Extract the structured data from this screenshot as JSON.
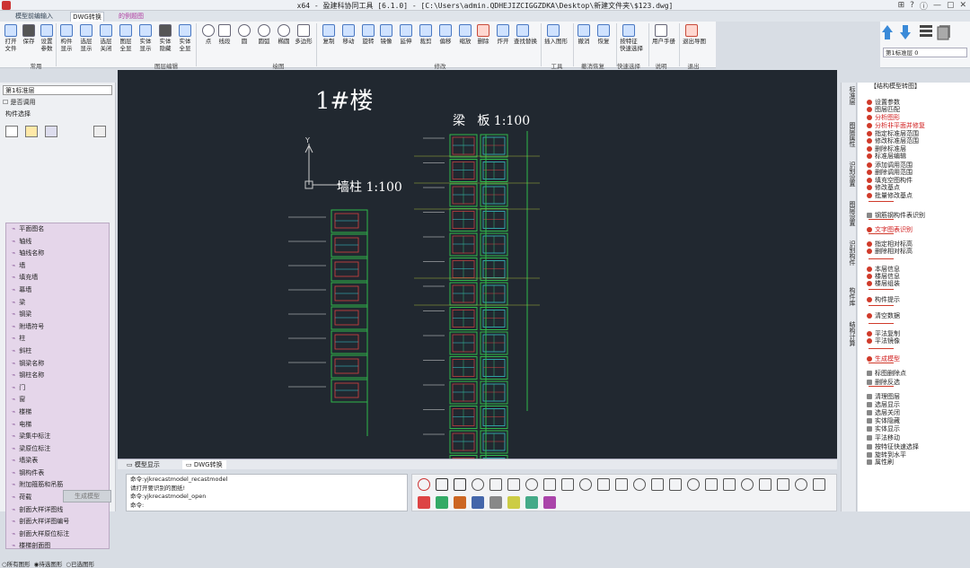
{
  "window": {
    "title": "x64 - 盈建科协同工具 [6.1.0] - [C:\\Users\\admin.QDHEJIZCIGGZDKA\\Desktop\\新建文件夹\\$123.dwg]",
    "controls": [
      "⊞",
      "?",
      "ⓘ",
      "—",
      "▢",
      "✕"
    ]
  },
  "tabs": [
    {
      "label": "模型前编输入"
    },
    {
      "label": "DWG转换"
    },
    {
      "label": "的例题图"
    }
  ],
  "ribbon": {
    "buttons": [
      {
        "label": "打开\n文件"
      },
      {
        "label": "保存"
      },
      {
        "label": "设置\n参数"
      },
      {
        "label": "构件\n显示"
      },
      {
        "label": "选层\n显示"
      },
      {
        "label": "选层\n关闭"
      },
      {
        "label": "图层\n全显"
      },
      {
        "label": "实体\n显示"
      },
      {
        "label": "实体\n隐藏"
      },
      {
        "label": "实体\n全显"
      },
      {
        "label": "点"
      },
      {
        "label": "线段"
      },
      {
        "label": "圆"
      },
      {
        "label": "圆弧"
      },
      {
        "label": "椭圆"
      },
      {
        "label": "多边形"
      },
      {
        "label": "复制"
      },
      {
        "label": "移动"
      },
      {
        "label": "旋转"
      },
      {
        "label": "镜像"
      },
      {
        "label": "延伸"
      },
      {
        "label": "裁剪"
      },
      {
        "label": "偏移"
      },
      {
        "label": "缩放"
      },
      {
        "label": "删除"
      },
      {
        "label": "炸开"
      },
      {
        "label": "查找替换"
      },
      {
        "label": "插入图形"
      },
      {
        "label": "撤消"
      },
      {
        "label": "恢复"
      },
      {
        "label": "按特征\n快速选择"
      },
      {
        "label": "用户手册"
      },
      {
        "label": "退出导图"
      }
    ],
    "groups": [
      "常用",
      "图层编辑",
      "绘图",
      "修改",
      "工具",
      "撤消恢复",
      "快速选择",
      "说明",
      "退出"
    ],
    "layer_select": "第1标准层 0"
  },
  "left_panel": {
    "floor_select": "第1标准层",
    "checkbox_label": "是否调用",
    "panel_title": "构件选择",
    "components": [
      "平面图名",
      "轴线",
      "轴线名称",
      "墙",
      "填充墙",
      "幕墙",
      "梁",
      "钢梁",
      "附墙符号",
      "柱",
      "斜柱",
      "钢梁名称",
      "钢柱名称",
      "门",
      "窗",
      "楼梯",
      "电梯",
      "梁集中标注",
      "梁原位标注",
      "墙梁表",
      "钢构件表",
      "附加箍筋和吊筋",
      "荷载",
      "剖面大样详图线",
      "剖面大样详图编号",
      "剖面大样原位标注",
      "楼梯剖面图"
    ],
    "radio_options": [
      "所有图形",
      "待选图形",
      "已选图形"
    ],
    "generate_button": "生成模型"
  },
  "canvas": {
    "title_building": "1#楼",
    "title_wall": "墙柱 1:100",
    "title_beam": "梁   板 1:100",
    "axis_y": "Y"
  },
  "canvas_tabs": [
    "模型显示",
    "DWG转换"
  ],
  "command_lines": [
    "命令:yjkrecastmodel_recastmodel",
    "请打开要识别的图纸!",
    "命令:yjkrecastmodel_open",
    "命令:"
  ],
  "right_vtabs": [
    "标准层",
    "图层属性",
    "识别设置",
    "图层设置",
    "识别构件",
    "构件库",
    "结构计算"
  ],
  "right_panel": {
    "header": "【结构模型转图】",
    "items": [
      {
        "label": "设置参数",
        "style": "dot"
      },
      {
        "label": "图层匹配",
        "style": "dot"
      },
      {
        "label": "分析图形",
        "style": "red"
      },
      {
        "label": "分析非平面并修复",
        "style": "red"
      },
      {
        "label": "指定标准层范围",
        "style": "dot"
      },
      {
        "label": "修改标准层范围",
        "style": "dot"
      },
      {
        "label": "删除标准层",
        "style": "dot"
      },
      {
        "label": "标准层编辑",
        "style": "dot"
      },
      {
        "label": "添加调用范围",
        "style": "dot"
      },
      {
        "label": "删除调用范围",
        "style": "dot"
      },
      {
        "label": "填充空图构件",
        "style": "dot"
      },
      {
        "label": "修改基点",
        "style": "dot"
      },
      {
        "label": "批量修改基点",
        "style": "dot"
      },
      {
        "label": "钢筋钢构件表识别",
        "style": "plain"
      },
      {
        "label": "文字图表识别",
        "style": "red"
      },
      {
        "label": "指定相对标高",
        "style": "dot"
      },
      {
        "label": "删除相对标高",
        "style": "dot"
      },
      {
        "label": "本层信息",
        "style": "dot"
      },
      {
        "label": "楼层信息",
        "style": "dot"
      },
      {
        "label": "楼层组装",
        "style": "dot"
      },
      {
        "label": "构件提示",
        "style": "dot"
      },
      {
        "label": "清空数据",
        "style": "dot"
      },
      {
        "label": "平法复制",
        "style": "dot"
      },
      {
        "label": "平法镜像",
        "style": "dot"
      },
      {
        "label": "生成模型",
        "style": "red"
      },
      {
        "label": "标图删除点",
        "style": "plain"
      },
      {
        "label": "删除反选",
        "style": "plain"
      },
      {
        "label": "清理图层",
        "style": "plain"
      },
      {
        "label": "选层显示",
        "style": "plain"
      },
      {
        "label": "选层关闭",
        "style": "plain"
      },
      {
        "label": "实体隐藏",
        "style": "plain"
      },
      {
        "label": "实体显示",
        "style": "plain"
      },
      {
        "label": "平法移动",
        "style": "plain"
      },
      {
        "label": "按特征快速选择",
        "style": "plain"
      },
      {
        "label": "旋转到水平",
        "style": "plain"
      },
      {
        "label": "属性刷",
        "style": "plain"
      }
    ]
  },
  "colors": {
    "canvas_bg": "#212830",
    "drawing_green": "#2fb84a",
    "drawing_red": "#d84040",
    "drawing_cyan": "#3ad0d8",
    "accent_red": "#d01a1a",
    "list_bg": "#e5d6ea"
  }
}
